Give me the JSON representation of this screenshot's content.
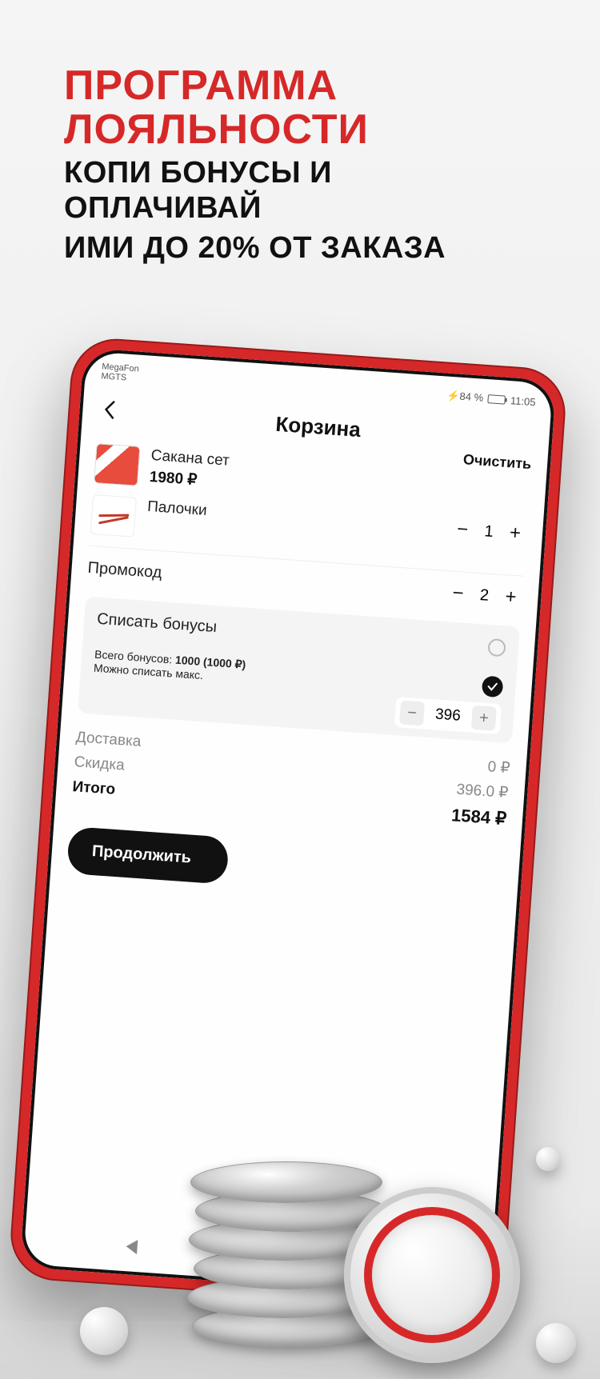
{
  "promo": {
    "title_line1": "ПРОГРАММА",
    "title_line2": "ЛОЯЛЬНОСТИ",
    "sub_line1": "КОПИ БОНУСЫ И ОПЛАЧИВАЙ",
    "sub_line2": "ИМИ ДО 20% ОТ ЗАКАЗА"
  },
  "status": {
    "carrier1": "MegaFon",
    "carrier2": "MGTS",
    "battery_pct": "84 %",
    "time": "11:05"
  },
  "header": {
    "title": "Корзина",
    "clear": "Очистить"
  },
  "items": [
    {
      "name": "Сакана сет",
      "price": "1980 ₽",
      "qty": "1"
    },
    {
      "name": "Палочки",
      "price": "",
      "qty": "2"
    }
  ],
  "promo_code_label": "Промокод",
  "bonus": {
    "title": "Списать бонусы",
    "total_label": "Всего бонусов:",
    "total_value": "1000 (1000 ₽)",
    "max_label": "Можно списать макс.",
    "stepper_value": "396"
  },
  "totals": {
    "delivery_label": "Доставка",
    "delivery_value": "0 ₽",
    "discount_label": "Скидка",
    "discount_value": "396.0 ₽",
    "final_label": "Итого",
    "final_value": "1584 ₽"
  },
  "continue_label": "Продолжить"
}
